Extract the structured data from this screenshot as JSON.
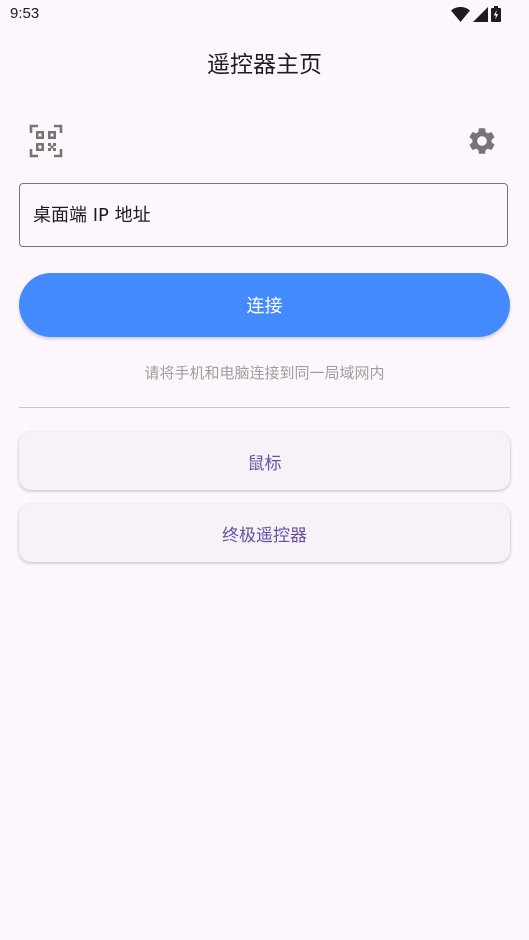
{
  "status_bar": {
    "time": "9:53",
    "icons": [
      "wifi-icon",
      "cellular-signal-icon",
      "battery-charging-icon"
    ]
  },
  "header": {
    "title": "遥控器主页"
  },
  "toolbar": {
    "scan_icon": "qr-scan-icon",
    "settings_icon": "gear-icon"
  },
  "form": {
    "ip_placeholder": "桌面端 IP 地址",
    "ip_value": "",
    "connect_label": "连接",
    "hint": "请将手机和电脑连接到同一局域网内"
  },
  "nav": {
    "mouse_label": "鼠标",
    "remote_label": "终极遥控器"
  },
  "colors": {
    "background": "#fdf7fd",
    "primary_button": "#448aff",
    "nav_text": "#6750a4",
    "hint_text": "#9e9e9e"
  }
}
